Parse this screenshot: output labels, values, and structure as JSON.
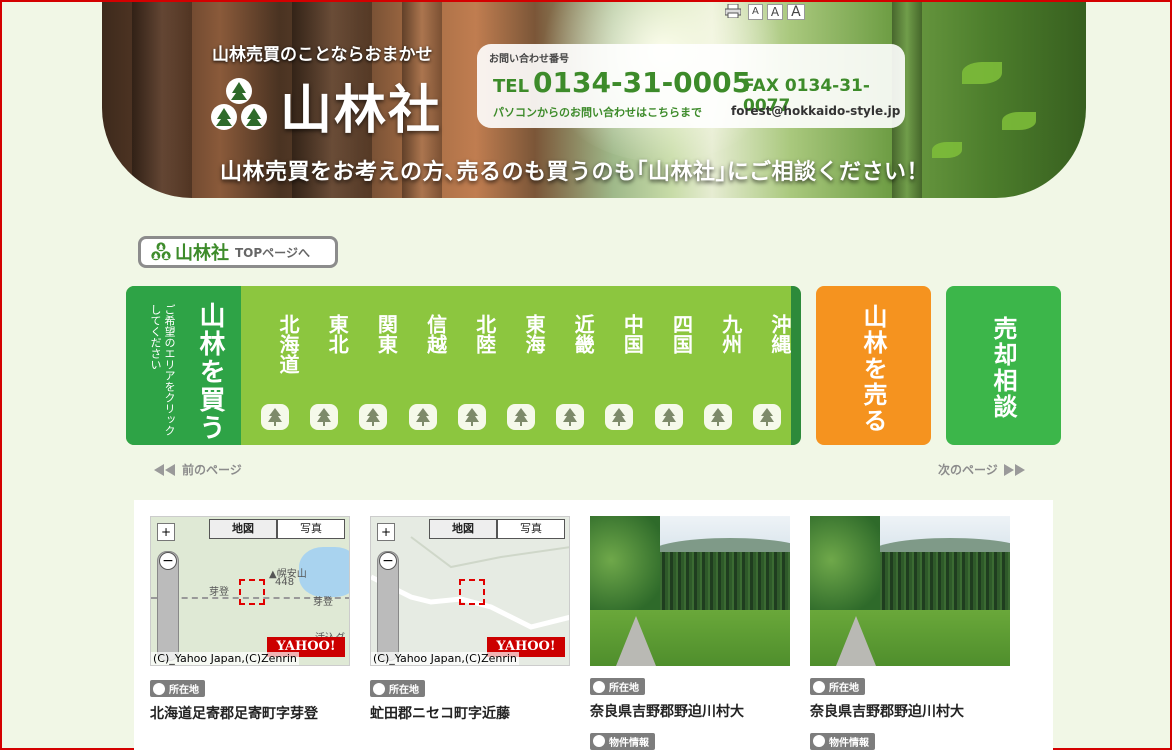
{
  "header": {
    "tagline": "山林売買のことならおまかせ",
    "brand": "山林社",
    "catch": "山林売買をお考えの方､売るのも買うのも｢山林社｣にご相談ください！",
    "tools": {
      "print_icon": "printer-icon",
      "font_small": "A",
      "font_medium": "A",
      "font_large": "A"
    },
    "contact": {
      "label": "お問い合わせ番号",
      "tel_prefix": "TEL",
      "tel": "0134-31-0005",
      "fax": "FAX 0134-31-0077",
      "pc_note": "パソコンからのお問い合わせはこちらまで",
      "email": "forest@hokkaido-style.jp"
    }
  },
  "toplink": {
    "brand": "山林社",
    "text": "TOPページへ"
  },
  "buy_nav": {
    "hint": "ご希望のエリアをクリックしてください",
    "title": "山林を買う",
    "areas": [
      {
        "label": "北海道"
      },
      {
        "label": "東北"
      },
      {
        "label": "関東"
      },
      {
        "label": "信越"
      },
      {
        "label": "北陸"
      },
      {
        "label": "東海"
      },
      {
        "label": "近畿"
      },
      {
        "label": "中国"
      },
      {
        "label": "四国"
      },
      {
        "label": "九州"
      },
      {
        "label": "沖縄"
      }
    ]
  },
  "sell_button": "山林を売る",
  "consult_button": "売却相談",
  "pager": {
    "prev": "前のページ",
    "next": "次のページ"
  },
  "listings": [
    {
      "type": "map",
      "map_tab": "地図",
      "photo_tab": "写真",
      "copyright": "(C)_Yahoo Japan,(C)Zenrin",
      "brand": "YAHOO!",
      "place1": "▲幌安山",
      "place2": "448",
      "place3": "芽登",
      "place4": "芽登",
      "place5": "活込ダ",
      "tag": "所在地",
      "address": "北海道足寄郡足寄町字芽登"
    },
    {
      "type": "map",
      "map_tab": "地図",
      "photo_tab": "写真",
      "copyright": "(C)_Yahoo Japan,(C)Zenrin",
      "brand": "YAHOO!",
      "tag": "所在地",
      "address": "虻田郡ニセコ町字近藤"
    },
    {
      "type": "photo",
      "tag": "所在地",
      "address": "奈良県吉野郡野迫川村大",
      "tag2": "物件情報"
    },
    {
      "type": "photo",
      "tag": "所在地",
      "address": "奈良県吉野郡野迫川村大",
      "tag2": "物件情報"
    }
  ],
  "colors": {
    "buy_green": "#8cc63f",
    "buy_dark": "#2ea346",
    "sell_orange": "#f5931f",
    "consult_green": "#3cb64a",
    "background": "#f1f7e6"
  }
}
